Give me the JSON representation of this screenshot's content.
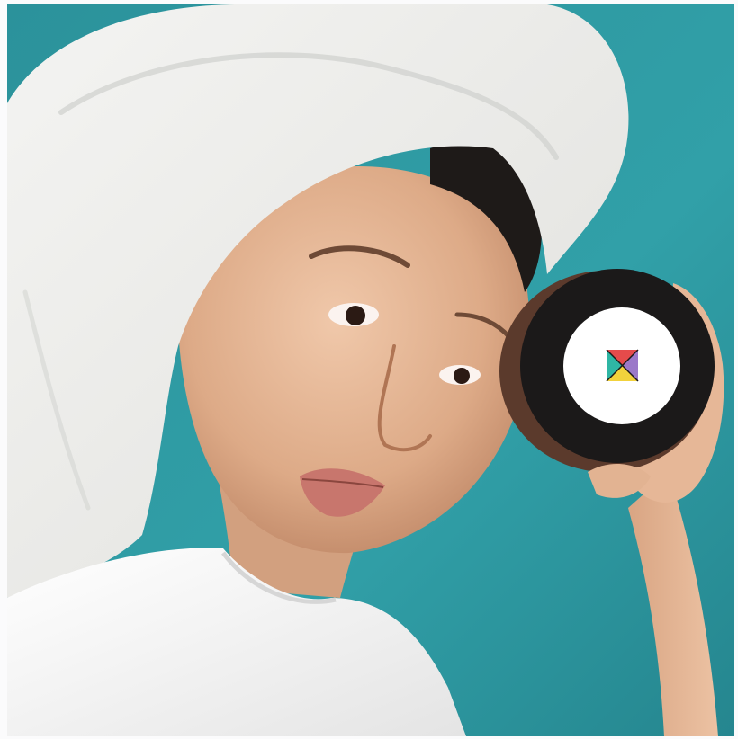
{
  "photo": {
    "subject": "woman-with-towel-holding-cosmetic-jar",
    "colors": {
      "backdrop": "#2f9aa3",
      "backdrop_dark": "#1f7d86",
      "towel": "#eeeeec",
      "towel_shadow": "#c9cac7",
      "skin": "#e2b392",
      "skin_shadow": "#b97f5e",
      "hair": "#1e1a18",
      "lips": "#c8766d",
      "shirt": "#f6f6f6",
      "jar_body": "#1b1919",
      "jar_rim": "#5b3a2c",
      "jar_label": "#ffffff"
    },
    "logo_colors": [
      "#e54b4b",
      "#9b79c9",
      "#f2d23c",
      "#2fb6a4"
    ]
  }
}
